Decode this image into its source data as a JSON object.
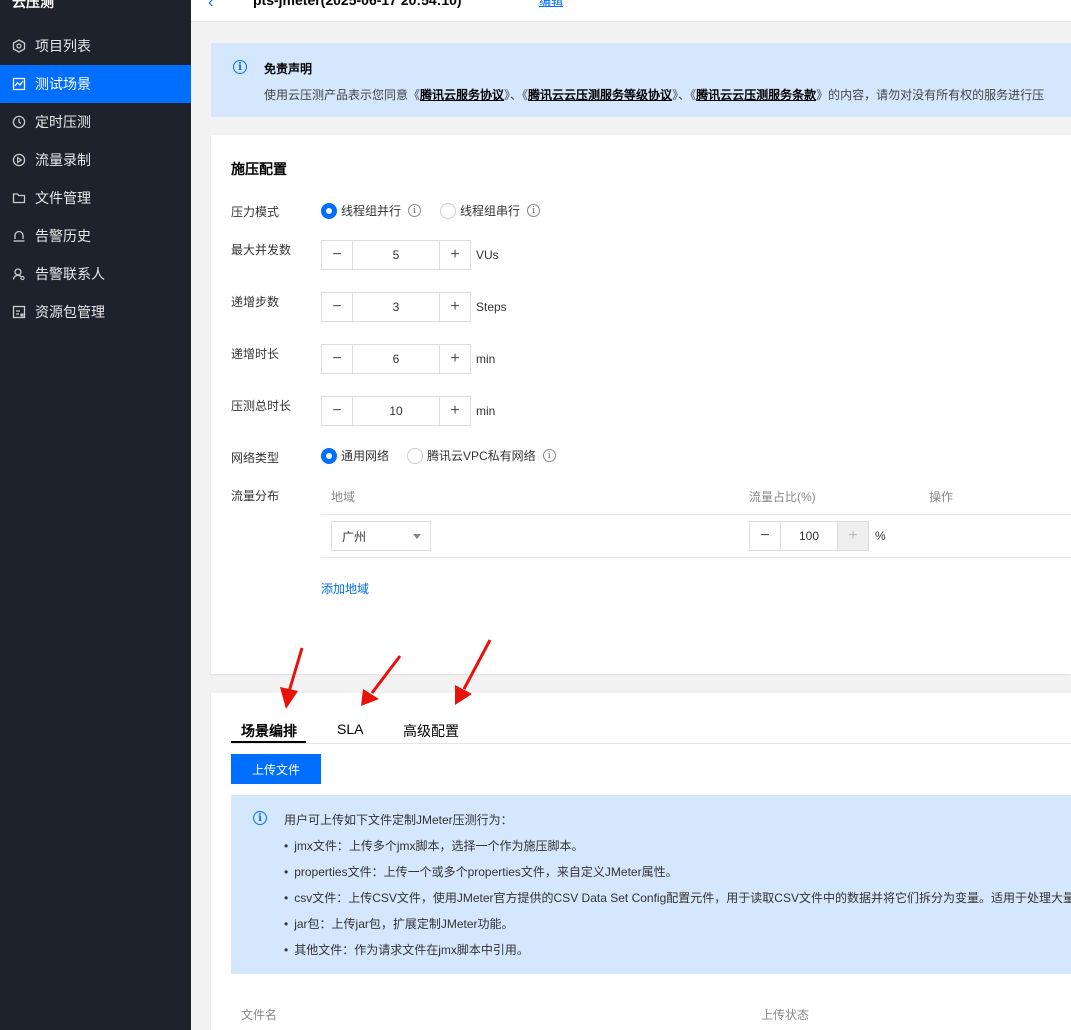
{
  "app": {
    "brand": "云压测"
  },
  "sidebar": {
    "items": [
      {
        "label": "项目列表",
        "icon": "hexagon-icon",
        "active": false
      },
      {
        "label": "测试场景",
        "icon": "chart-icon",
        "active": true
      },
      {
        "label": "定时压测",
        "icon": "clock-icon",
        "active": false
      },
      {
        "label": "流量录制",
        "icon": "play-icon",
        "active": false
      },
      {
        "label": "文件管理",
        "icon": "folder-icon",
        "active": false
      },
      {
        "label": "告警历史",
        "icon": "alarm-icon",
        "active": false
      },
      {
        "label": "告警联系人",
        "icon": "contact-icon",
        "active": false
      },
      {
        "label": "资源包管理",
        "icon": "package-icon",
        "active": false
      }
    ]
  },
  "topbar": {
    "title": "pts-jmeter(2025-06-17 20:54:10)",
    "link": "编辑"
  },
  "notice": {
    "title": "免责声明",
    "prefix": "使用云压测产品表示您同意《",
    "link1": "腾讯云服务协议",
    "sep1": "》、《",
    "link2": "腾讯云云压测服务等级协议",
    "sep2": "》、《",
    "link3": "腾讯云云压测服务条款",
    "suffix": "》的内容，请勿对没有所有权的服务进行压"
  },
  "config": {
    "title": "施压配置",
    "mode": {
      "label": "压力模式",
      "option1": "线程组并行",
      "option2": "线程组串行"
    },
    "max_concurrency": {
      "label": "最大并发数",
      "value": "5",
      "unit": "VUs"
    },
    "ramp_steps": {
      "label": "递增步数",
      "value": "3",
      "unit": "Steps"
    },
    "ramp_duration": {
      "label": "递增时长",
      "value": "6",
      "unit": "min"
    },
    "total_duration": {
      "label": "压测总时长",
      "value": "10",
      "unit": "min"
    },
    "network": {
      "label": "网络类型",
      "option1": "通用网络",
      "option2": "腾讯云VPC私有网络"
    },
    "traffic": {
      "label": "流量分布",
      "col_region": "地域",
      "col_ratio": "流量占比(%)",
      "col_action": "操作",
      "region": "广州",
      "ratio": "100",
      "ratio_unit": "%",
      "add_link": "添加地域"
    }
  },
  "tabs": {
    "items": [
      "场景编排",
      "SLA",
      "高级配置"
    ]
  },
  "upload": {
    "button": "上传文件",
    "info_head": "用户可上传如下文件定制JMeter压测行为：",
    "bullets": [
      "jmx文件：上传多个jmx脚本，选择一个作为施压脚本。",
      "properties文件：上传一个或多个properties文件，来自定义JMeter属性。",
      "csv文件：上传CSV文件，使用JMeter官方提供的CSV Data Set Config配置元件，用于读取CSV文件中的数据并将它们拆分为变量。适用于处理大量",
      "jar包：上传jar包，扩展定制JMeter功能。",
      "其他文件：作为请求文件在jmx脚本中引用。"
    ],
    "col_name": "文件名",
    "col_status": "上传状态"
  },
  "colors": {
    "accent": "#006eff",
    "sidebar_bg": "#1e222d",
    "notice_bg": "#d5e7fd",
    "annotation_arrow": "#e8120c"
  }
}
